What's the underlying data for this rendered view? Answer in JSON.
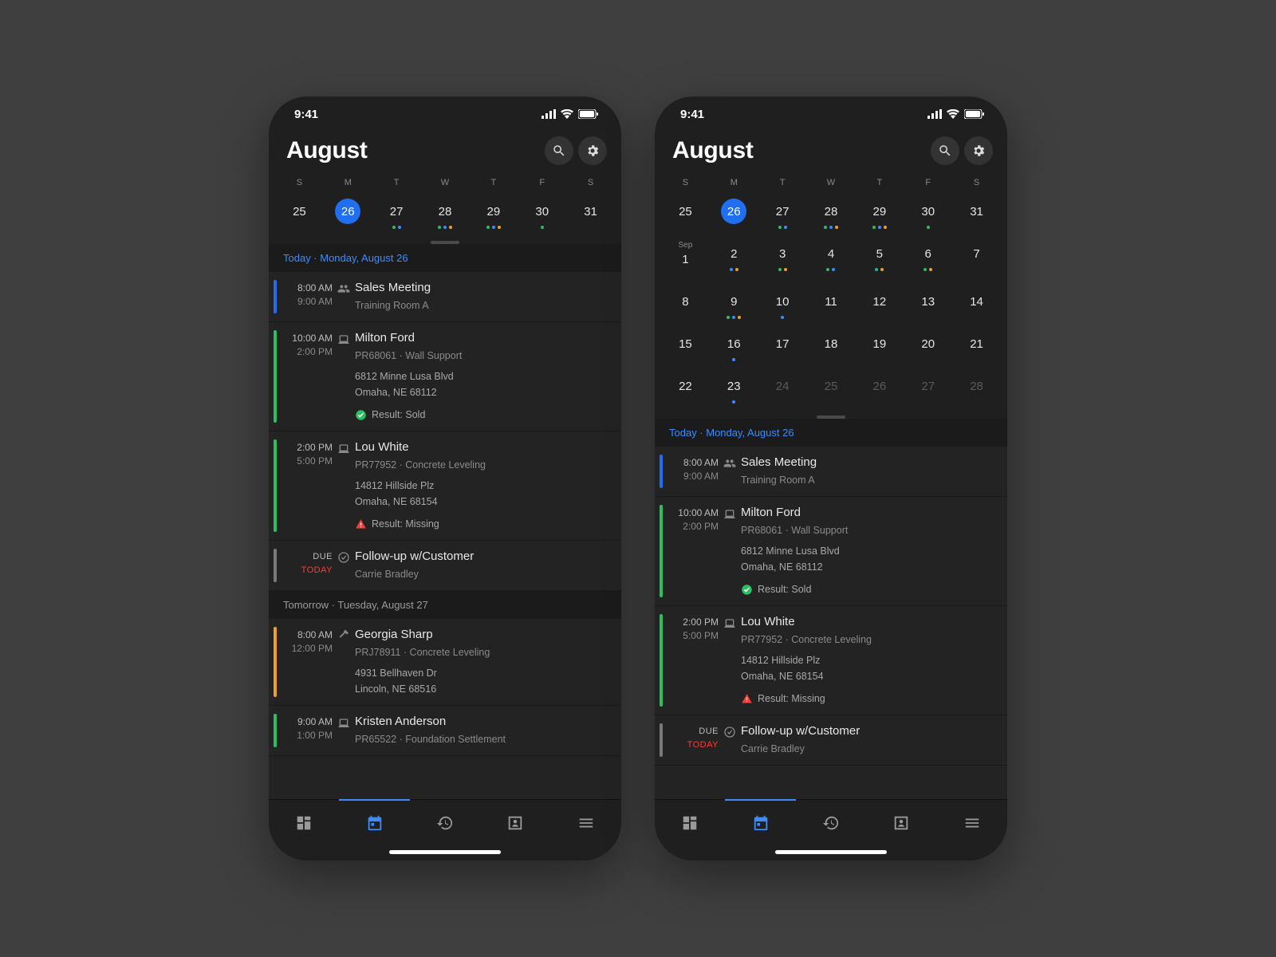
{
  "status": {
    "time": "9:41"
  },
  "header": {
    "month": "August"
  },
  "dow": [
    "S",
    "M",
    "T",
    "W",
    "T",
    "F",
    "S"
  ],
  "left": {
    "days": [
      {
        "n": "25"
      },
      {
        "n": "26",
        "sel": true
      },
      {
        "n": "27",
        "dots": [
          "green",
          "blue"
        ]
      },
      {
        "n": "28",
        "dots": [
          "green",
          "blue",
          "orange"
        ]
      },
      {
        "n": "29",
        "dots": [
          "green",
          "blue",
          "orange"
        ]
      },
      {
        "n": "30",
        "dots": [
          "green"
        ]
      },
      {
        "n": "31"
      }
    ],
    "section1": "Today · Monday, August 26",
    "section2": "Tomorrow · Tuesday, August 27"
  },
  "right": {
    "section1": "Today · Monday, August 26",
    "rows": [
      [
        {
          "n": "25"
        },
        {
          "n": "26",
          "sel": true
        },
        {
          "n": "27",
          "dots": [
            "green",
            "blue"
          ]
        },
        {
          "n": "28",
          "dots": [
            "green",
            "blue",
            "orange"
          ]
        },
        {
          "n": "29",
          "dots": [
            "green",
            "blue",
            "orange"
          ]
        },
        {
          "n": "30",
          "dots": [
            "green"
          ]
        },
        {
          "n": "31"
        }
      ],
      [
        {
          "n": "1",
          "mlabel": "Sep"
        },
        {
          "n": "2",
          "dots": [
            "blue",
            "orange"
          ]
        },
        {
          "n": "3",
          "dots": [
            "green",
            "orange"
          ]
        },
        {
          "n": "4",
          "dots": [
            "green",
            "blue"
          ]
        },
        {
          "n": "5",
          "dots": [
            "teal",
            "orange"
          ]
        },
        {
          "n": "6",
          "dots": [
            "green",
            "orange"
          ]
        },
        {
          "n": "7"
        }
      ],
      [
        {
          "n": "8"
        },
        {
          "n": "9",
          "dots": [
            "green",
            "blue",
            "orange"
          ]
        },
        {
          "n": "10",
          "dots": [
            "blue"
          ]
        },
        {
          "n": "11"
        },
        {
          "n": "12"
        },
        {
          "n": "13"
        },
        {
          "n": "14"
        }
      ],
      [
        {
          "n": "15"
        },
        {
          "n": "16",
          "dots": [
            "blue"
          ]
        },
        {
          "n": "17"
        },
        {
          "n": "18"
        },
        {
          "n": "19"
        },
        {
          "n": "20"
        },
        {
          "n": "21"
        }
      ],
      [
        {
          "n": "22"
        },
        {
          "n": "23",
          "dots": [
            "blue"
          ]
        },
        {
          "n": "24",
          "muted": true
        },
        {
          "n": "25",
          "muted": true
        },
        {
          "n": "26",
          "muted": true
        },
        {
          "n": "27",
          "muted": true
        },
        {
          "n": "28",
          "muted": true
        }
      ]
    ]
  },
  "events": {
    "e1": {
      "t1": "8:00 AM",
      "t2": "9:00 AM",
      "title": "Sales Meeting",
      "sub": "Training Room A",
      "stripe": "#1f6ff0",
      "icon": "people"
    },
    "e2": {
      "t1": "10:00 AM",
      "t2": "2:00 PM",
      "title": "Milton Ford",
      "sub": "PR68061 · Wall Support",
      "addr1": "6812 Minne Lusa Blvd",
      "addr2": "Omaha, NE 68112",
      "result": "Result: Sold",
      "resIcon": "sold",
      "stripe": "#2bbf62",
      "icon": "laptop"
    },
    "e3": {
      "t1": "2:00 PM",
      "t2": "5:00 PM",
      "title": "Lou White",
      "sub": "PR77952 · Concrete Leveling",
      "addr1": "14812 Hillside Plz",
      "addr2": "Omaha, NE 68154",
      "result": "Result: Missing",
      "resIcon": "miss",
      "stripe": "#2bbf62",
      "icon": "laptop"
    },
    "e4": {
      "due": "DUE",
      "today": "TODAY",
      "title": "Follow-up w/Customer",
      "sub": "Carrie Bradley",
      "stripe": "#7a7a7a",
      "icon": "check"
    },
    "e5": {
      "t1": "8:00 AM",
      "t2": "12:00 PM",
      "title": "Georgia Sharp",
      "sub": "PRJ78911 · Concrete Leveling",
      "addr1": "4931 Bellhaven Dr",
      "addr2": "Lincoln, NE 68516",
      "stripe": "#f0a020",
      "icon": "hammer"
    },
    "e6": {
      "t1": "9:00 AM",
      "t2": "1:00 PM",
      "title": "Kristen Anderson",
      "sub": "PR65522 · Foundation Settlement",
      "stripe": "#2bbf62",
      "icon": "laptop"
    }
  }
}
